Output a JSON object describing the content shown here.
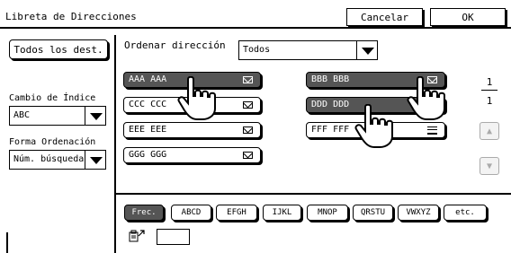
{
  "window": {
    "title": "Libreta de Direcciones"
  },
  "top_buttons": {
    "cancel": "Cancelar",
    "ok": "OK"
  },
  "left_panel": {
    "all_destinations": "Todos los dest.",
    "index_change_label": "Cambio de Índice",
    "index_value": "ABC",
    "sort_form_label": "Forma Ordenación",
    "sort_form_value": "Núm. búsqueda"
  },
  "sort_address": {
    "label": "Ordenar dirección",
    "value": "Todos"
  },
  "entries": [
    {
      "name": "AAA AAA",
      "selected": true,
      "icon": "mail-icon"
    },
    {
      "name": "BBB BBB",
      "selected": true,
      "icon": "mail-icon"
    },
    {
      "name": "CCC CCC",
      "selected": false,
      "icon": "mail-icon"
    },
    {
      "name": "DDD DDD",
      "selected": true,
      "icon": "mail-icon"
    },
    {
      "name": "EEE EEE",
      "selected": false,
      "icon": "mail-icon"
    },
    {
      "name": "FFF FFF",
      "selected": false,
      "icon": "fax-icon"
    },
    {
      "name": "GGG GGG",
      "selected": false,
      "icon": "mail-icon"
    }
  ],
  "pager": {
    "current": "1",
    "total": "1"
  },
  "index_tabs": [
    "Frec.",
    "ABCD",
    "EFGH",
    "IJKL",
    "MNOP",
    "QRSTU",
    "VWXYZ",
    "etc."
  ],
  "colors": {
    "selected_entry": "#555555",
    "border": "#000000",
    "disabled": "#aaaaaa"
  }
}
